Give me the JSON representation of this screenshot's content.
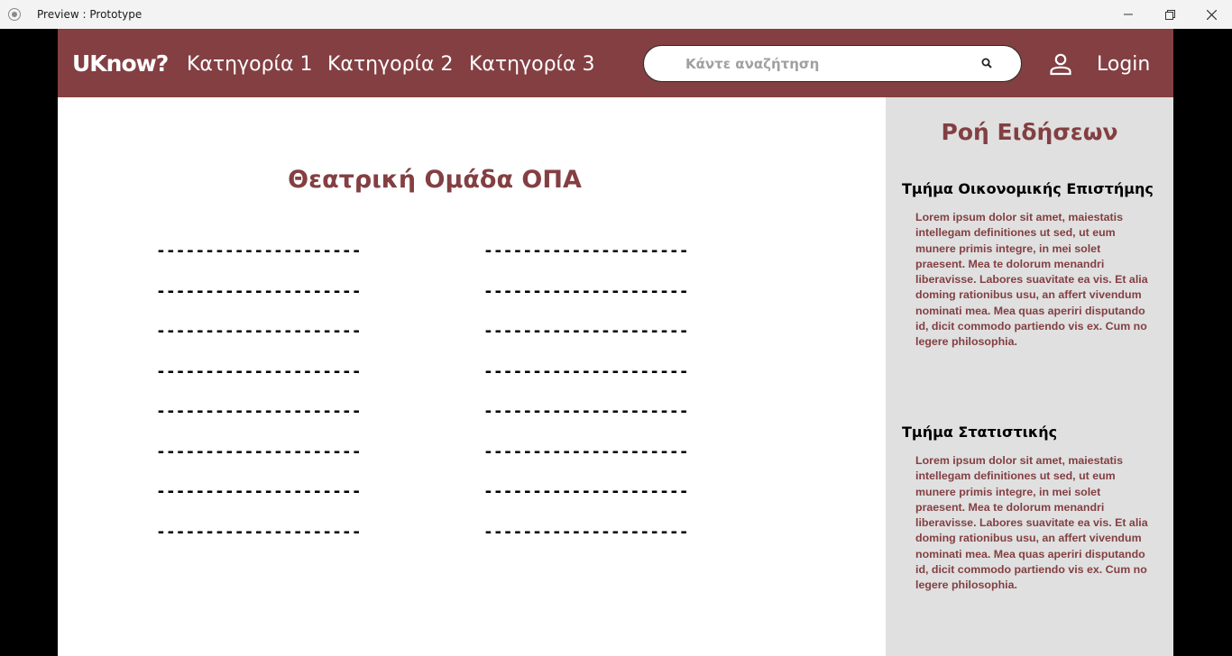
{
  "window": {
    "title": "Preview : Prototype"
  },
  "header": {
    "logo": "UKnow?",
    "nav": [
      "Κατηγορία 1",
      "Κατηγορία 2",
      "Κατηγορία 3"
    ],
    "search_placeholder": "Κάντε αναζήτηση",
    "login_label": "Login"
  },
  "main": {
    "title": "Θεατρική Ομάδα ΟΠΑ",
    "left_items": [
      "---------------------",
      "---------------------",
      "---------------------",
      "---------------------",
      "---------------------",
      "---------------------",
      "---------------------",
      "---------------------"
    ],
    "right_items": [
      "---------------------",
      "---------------------",
      "---------------------",
      "---------------------",
      "---------------------",
      "---------------------",
      "---------------------",
      "---------------------"
    ]
  },
  "sidebar": {
    "title": "Ροή Ειδήσεων",
    "news": [
      {
        "heading": "Τμήμα Οικονομικής Επιστήμης",
        "body": "Lorem ipsum dolor sit amet, maiestatis intellegam definitiones ut sed, ut eum munere primis integre, in mei solet praesent. Mea te dolorum menandri liberavisse. Labores suavitate ea vis. Et alia doming rationibus usu, an affert vivendum nominati mea. Mea quas aperiri disputando id, dicit commodo partiendo vis ex. Cum no legere philosophia."
      },
      {
        "heading": "Τμήμα Στατιστικής",
        "body": "Lorem ipsum dolor sit amet, maiestatis intellegam definitiones ut sed, ut eum munere primis integre, in mei solet praesent. Mea te dolorum menandri liberavisse. Labores suavitate ea vis. Et alia doming rationibus usu, an affert vivendum nominati mea. Mea quas aperiri disputando id, dicit commodo partiendo vis ex. Cum no legere philosophia."
      }
    ]
  },
  "colors": {
    "brand": "#833f42",
    "sidebar_bg": "#e0e0e0",
    "titlebar_bg": "#f3f3f3"
  }
}
